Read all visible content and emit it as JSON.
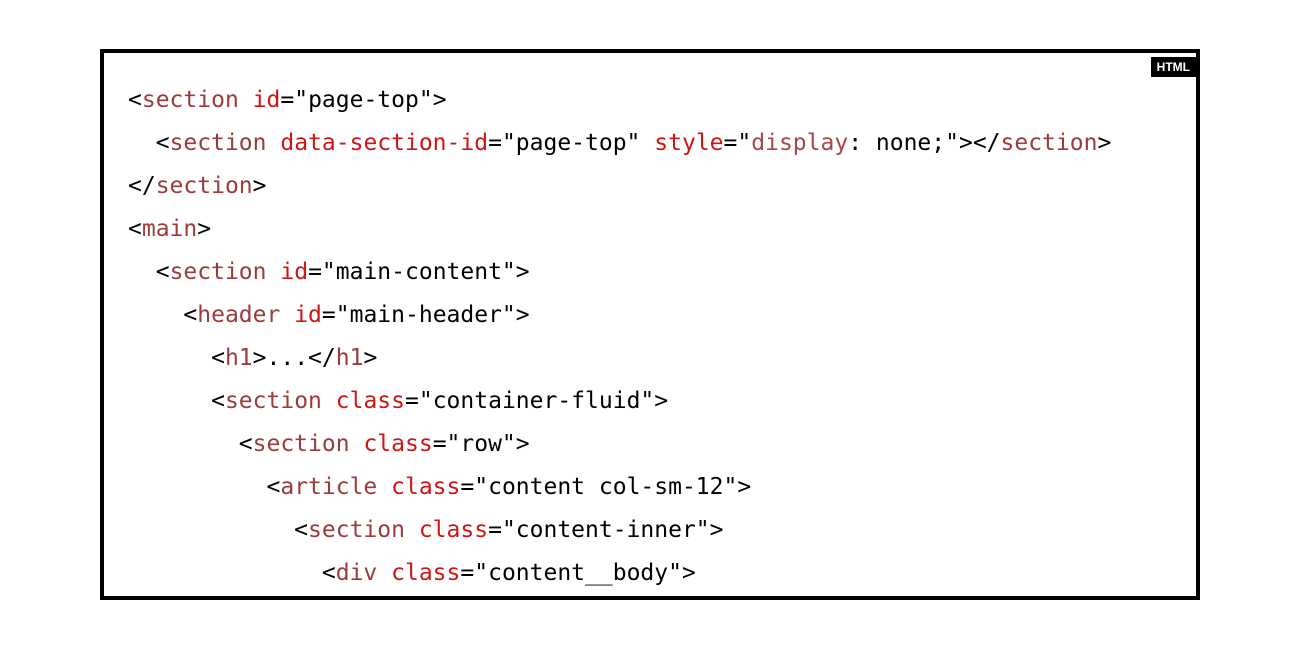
{
  "badge": {
    "label": "HTML"
  },
  "colors": {
    "tag": "#9c3b3b",
    "attr": "#d01515",
    "text": "#000000",
    "border": "#000000"
  },
  "code_lines": [
    {
      "indent": 0,
      "tokens": [
        [
          "p",
          "<"
        ],
        [
          "tag",
          "section"
        ],
        [
          "p",
          " "
        ],
        [
          "attr",
          "id"
        ],
        [
          "p",
          "="
        ],
        [
          "str",
          "\"page-top\""
        ],
        [
          "p",
          ">"
        ]
      ]
    },
    {
      "indent": 1,
      "tokens": [
        [
          "p",
          "<"
        ],
        [
          "tag",
          "section"
        ],
        [
          "p",
          " "
        ],
        [
          "attr",
          "data-section-id"
        ],
        [
          "p",
          "="
        ],
        [
          "str",
          "\"page-top\""
        ],
        [
          "p",
          " "
        ],
        [
          "attr",
          "style"
        ],
        [
          "p",
          "="
        ],
        [
          "str",
          "\""
        ],
        [
          "prop",
          "display"
        ],
        [
          "str",
          ": none;\""
        ],
        [
          "p",
          "></"
        ],
        [
          "tag",
          "section"
        ],
        [
          "p",
          ">"
        ]
      ]
    },
    {
      "indent": 0,
      "tokens": [
        [
          "p",
          "</"
        ],
        [
          "tag",
          "section"
        ],
        [
          "p",
          ">"
        ]
      ]
    },
    {
      "indent": 0,
      "tokens": [
        [
          "p",
          "<"
        ],
        [
          "tag",
          "main"
        ],
        [
          "p",
          ">"
        ]
      ]
    },
    {
      "indent": 1,
      "tokens": [
        [
          "p",
          "<"
        ],
        [
          "tag",
          "section"
        ],
        [
          "p",
          " "
        ],
        [
          "attr",
          "id"
        ],
        [
          "p",
          "="
        ],
        [
          "str",
          "\"main-content\""
        ],
        [
          "p",
          ">"
        ]
      ]
    },
    {
      "indent": 2,
      "tokens": [
        [
          "p",
          "<"
        ],
        [
          "tag",
          "header"
        ],
        [
          "p",
          " "
        ],
        [
          "attr",
          "id"
        ],
        [
          "p",
          "="
        ],
        [
          "str",
          "\"main-header\""
        ],
        [
          "p",
          ">"
        ]
      ]
    },
    {
      "indent": 3,
      "tokens": [
        [
          "p",
          "<"
        ],
        [
          "tag",
          "h1"
        ],
        [
          "p",
          ">...</"
        ],
        [
          "tag",
          "h1"
        ],
        [
          "p",
          ">"
        ]
      ]
    },
    {
      "indent": 3,
      "tokens": [
        [
          "p",
          "<"
        ],
        [
          "tag",
          "section"
        ],
        [
          "p",
          " "
        ],
        [
          "attr",
          "class"
        ],
        [
          "p",
          "="
        ],
        [
          "str",
          "\"container-fluid\""
        ],
        [
          "p",
          ">"
        ]
      ]
    },
    {
      "indent": 4,
      "tokens": [
        [
          "p",
          "<"
        ],
        [
          "tag",
          "section"
        ],
        [
          "p",
          " "
        ],
        [
          "attr",
          "class"
        ],
        [
          "p",
          "="
        ],
        [
          "str",
          "\"row\""
        ],
        [
          "p",
          ">"
        ]
      ]
    },
    {
      "indent": 5,
      "tokens": [
        [
          "p",
          "<"
        ],
        [
          "tag",
          "article"
        ],
        [
          "p",
          " "
        ],
        [
          "attr",
          "class"
        ],
        [
          "p",
          "="
        ],
        [
          "str",
          "\"content col-sm-12\""
        ],
        [
          "p",
          ">"
        ]
      ]
    },
    {
      "indent": 6,
      "tokens": [
        [
          "p",
          "<"
        ],
        [
          "tag",
          "section"
        ],
        [
          "p",
          " "
        ],
        [
          "attr",
          "class"
        ],
        [
          "p",
          "="
        ],
        [
          "str",
          "\"content-inner\""
        ],
        [
          "p",
          ">"
        ]
      ]
    },
    {
      "indent": 7,
      "tokens": [
        [
          "p",
          "<"
        ],
        [
          "tag",
          "div"
        ],
        [
          "p",
          " "
        ],
        [
          "attr",
          "class"
        ],
        [
          "p",
          "="
        ],
        [
          "str",
          "\"content__body\""
        ],
        [
          "p",
          ">"
        ]
      ]
    }
  ]
}
